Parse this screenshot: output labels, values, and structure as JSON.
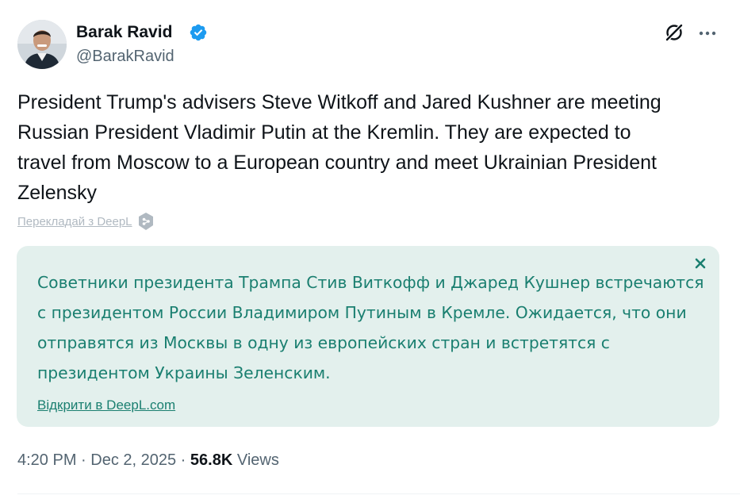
{
  "author": {
    "name": "Barak Ravid",
    "handle": "@BarakRavid",
    "verified": true,
    "verified_color": "#1d9bf0",
    "avatar_icon": "profile-photo"
  },
  "header_actions": {
    "grok_icon": "grok-icon",
    "more_icon": "more-horizontal-icon"
  },
  "tweet": {
    "text": "President Trump's advisers Steve Witkoff and Jared Kushner are meeting\nRussian President Vladimir Putin at the Kremlin. They are expected to\ntravel from Moscow to a European country and meet Ukrainian President\nZelensky"
  },
  "translate": {
    "link_label": "Перекладай з DeepL",
    "icon": "deepl-icon"
  },
  "translation": {
    "text": "Советники президента Трампа Стив Виткофф и Джаред Кушнер встречаются\nс президентом России Владимиром Путиным в Кремле. Ожидается, что они\nотправятся из Москвы в одну из европейских стран и встретятся с\nпрезидентом Украины Зеленским.",
    "open_link_label": "Відкрити в DeepL.com",
    "close_icon": "close-icon",
    "background_color": "#e3f0ed",
    "text_color": "#1a7f70"
  },
  "meta": {
    "time": "4:20 PM",
    "separator": " · ",
    "date": "Dec 2, 2025",
    "views_count": "56.8K",
    "views_label": "Views"
  }
}
